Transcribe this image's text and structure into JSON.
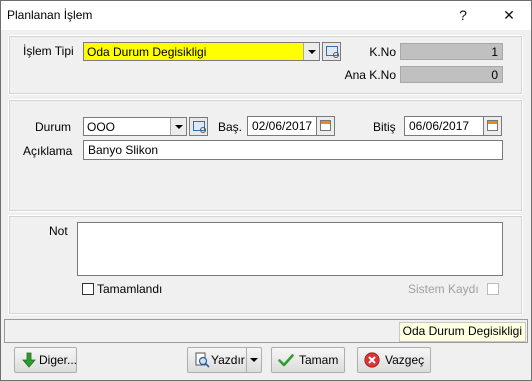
{
  "window": {
    "title": "Planlanan İşlem",
    "help_glyph": "?",
    "close_glyph": "✕"
  },
  "top_panel": {
    "islem_tipi_label": "İşlem Tipi",
    "islem_tipi_value": "Oda Durum Degisikligi",
    "islem_tipi_highlight": "#ffff00",
    "kno_label": "K.No",
    "kno_value": "1",
    "ana_kno_label": "Ana K.No",
    "ana_kno_value": "0"
  },
  "middle_panel": {
    "durum_label": "Durum",
    "durum_value": "OOO",
    "bas_label": "Baş.",
    "bas_value": "02/06/2017",
    "bitis_label": "Bitiş",
    "bitis_value": "06/06/2017",
    "aciklama_label": "Açıklama",
    "aciklama_value": "Banyo Slikon"
  },
  "bottom_panel": {
    "not_label": "Not",
    "not_value": "",
    "tamamlandi_label": "Tamamlandı",
    "tamamlandi_checked": false,
    "sistem_kaydi_label": "Sistem Kaydı",
    "sistem_kaydi_checked": false
  },
  "status": {
    "text": "Oda Durum Degisikligi"
  },
  "buttons": {
    "diger_label": "Diger...",
    "yazdir_label": "Yazdır",
    "tamam_label": "Tamam",
    "vazgec_label": "Vazgeç"
  }
}
